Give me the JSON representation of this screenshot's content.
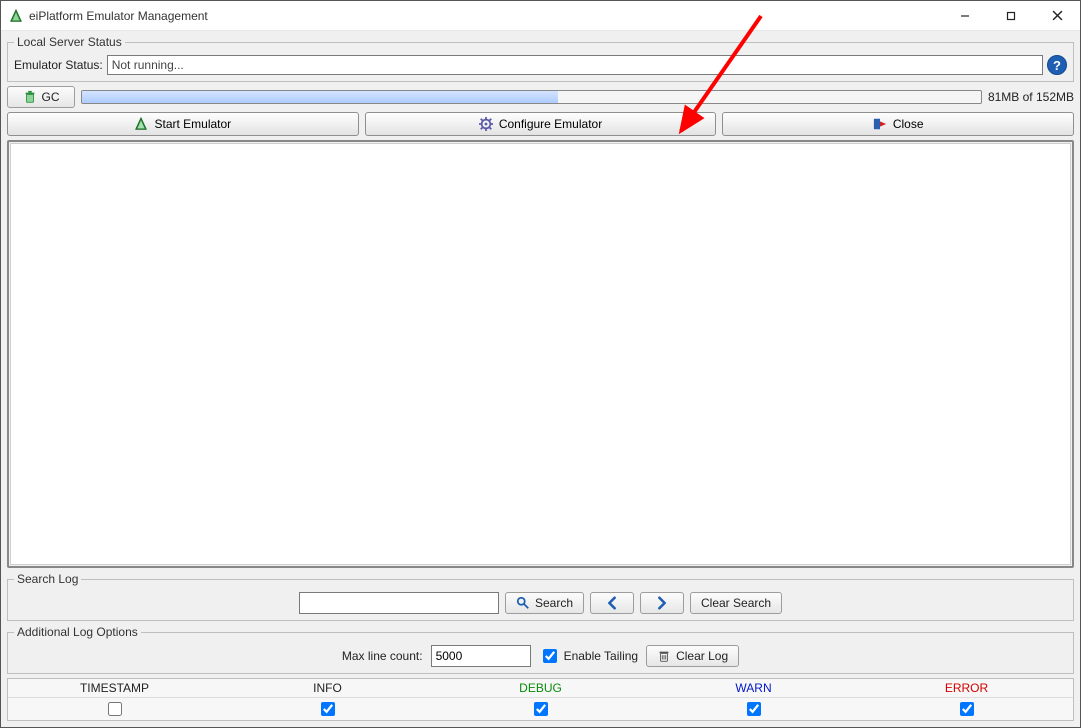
{
  "window": {
    "title": "eiPlatform Emulator Management"
  },
  "status_group": {
    "legend": "Local Server Status",
    "label": "Emulator Status:",
    "value": "Not running..."
  },
  "memory": {
    "gc_label": "GC",
    "used_mb": "81MB",
    "total_mb": "152MB",
    "display": "81MB of 152MB",
    "percent": 53
  },
  "main_buttons": {
    "start": "Start Emulator",
    "configure": "Configure Emulator",
    "close": "Close"
  },
  "search_group": {
    "legend": "Search Log",
    "search_value": "",
    "search_label": "Search",
    "prev_label": "Previous",
    "next_label": "Next",
    "clear_label": "Clear Search"
  },
  "opts_group": {
    "legend": "Additional Log Options",
    "maxline_label": "Max line count:",
    "maxline_value": "5000",
    "tailing_label": "Enable Tailing",
    "tailing_checked": true,
    "clear_log_label": "Clear Log"
  },
  "levels": {
    "timestamp": {
      "label": "TIMESTAMP",
      "checked": false
    },
    "info": {
      "label": "INFO",
      "checked": true
    },
    "debug": {
      "label": "DEBUG",
      "checked": true
    },
    "warn": {
      "label": "WARN",
      "checked": true
    },
    "error": {
      "label": "ERROR",
      "checked": true
    }
  }
}
